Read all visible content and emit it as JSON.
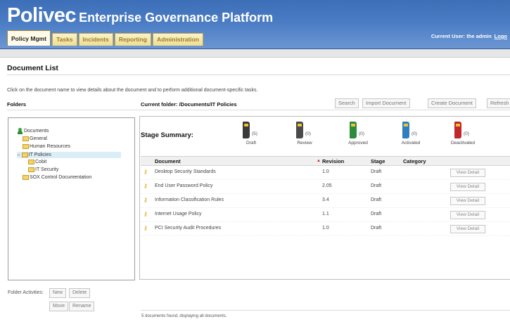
{
  "app": {
    "brand_main": "Polivec",
    "brand_sub": "Enterprise Governance Platform",
    "current_user": "Current User: the admin",
    "logout_label": "Logo"
  },
  "tabs": [
    {
      "label": "Policy Mgmt"
    },
    {
      "label": "Tasks"
    },
    {
      "label": "Incidents"
    },
    {
      "label": "Reporting"
    },
    {
      "label": "Administration"
    }
  ],
  "page": {
    "title": "Document List",
    "instructions": "Click on the document name to view details about the document and to perform additional document-specific tasks.",
    "folders_label": "Folders",
    "current_folder": "Current folder: /Documents/IT Policies"
  },
  "toolbar": {
    "search": "Search",
    "import": "Import Document",
    "create": "Create Document",
    "refresh": "Refresh"
  },
  "tree": {
    "root": "Documents",
    "items": [
      {
        "label": "General"
      },
      {
        "label": "Human Resources"
      },
      {
        "label": "IT Policies"
      },
      {
        "label": "Cobit"
      },
      {
        "label": "IT Security"
      },
      {
        "label": "SOX Control Documentation"
      }
    ],
    "expander": "−"
  },
  "folder_activities": {
    "label": "Folder Activities:",
    "new": "New",
    "delete": "Delete",
    "move": "Move",
    "rename": "Rename"
  },
  "stage_summary": {
    "label": "Stage Summary:",
    "stages": [
      {
        "name": "Draft",
        "count": "(5)",
        "color": "#3a3a3a"
      },
      {
        "name": "Review",
        "count": "(0)",
        "color": "#4a4a4a"
      },
      {
        "name": "Approved",
        "count": "(0)",
        "color": "#2e8b3d"
      },
      {
        "name": "Activated",
        "count": "(0)",
        "color": "#2f7fc0"
      },
      {
        "name": "Deactivated",
        "count": "(0)",
        "color": "#c0282d"
      }
    ]
  },
  "table": {
    "columns": {
      "document": "Document",
      "revision": "Revision",
      "stage": "Stage",
      "category": "Category"
    },
    "sort_marker": "▲",
    "view_label": "View Detail",
    "rows": [
      {
        "document": "Desktop Security Standards",
        "revision": "1.0",
        "stage": "Draft"
      },
      {
        "document": "End User Password Policy",
        "revision": "2.05",
        "stage": "Draft"
      },
      {
        "document": "Information Classification Rules",
        "revision": "3.4",
        "stage": "Draft"
      },
      {
        "document": "Internet Usage Policy",
        "revision": "1.1",
        "stage": "Draft"
      },
      {
        "document": "PCI Security Audit Procedures",
        "revision": "1.0",
        "stage": "Draft"
      }
    ]
  },
  "status": "5 documents found, displaying all documents."
}
